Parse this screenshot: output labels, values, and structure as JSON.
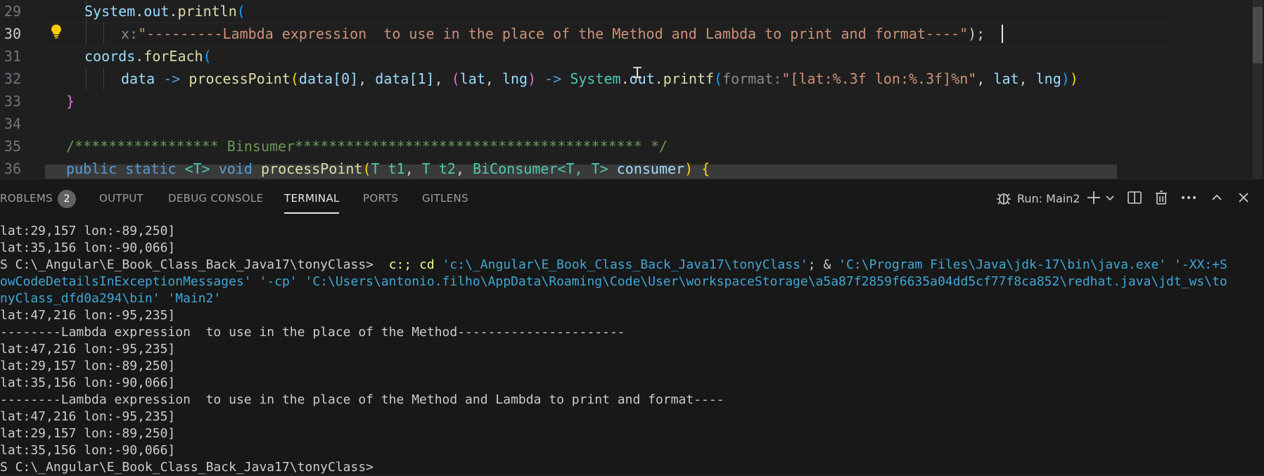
{
  "editor": {
    "line_numbers": [
      "29",
      "30",
      "31",
      "32",
      "33",
      "34",
      "35",
      "36"
    ],
    "tokens": {
      "system": "System",
      "out": "out",
      "println": "println",
      "hint_x": "x:",
      "message": "\"---------Lambda expression  to use in the place of the Method and Lambda to print and format----\"",
      "close_semicolon": ");",
      "coords": "coords",
      "foreach": "forEach",
      "data": "data",
      "arrow": "->",
      "processpoint": "processPoint",
      "data0": "data[0]",
      "data1": "data[1]",
      "lat": "lat",
      "lng": "lng",
      "printf": "printf",
      "hint_format": "format:",
      "format_str": "\"[lat:%.3f lon:%.3f]%n\"",
      "close_brace": "}",
      "comment": "/***************** Binsumer***************************************** */",
      "public": "public",
      "static": "static",
      "generic_t": "<T>",
      "void": "void",
      "param_t1": "T t1",
      "param_t2": "T t2",
      "biconsumer": "BiConsumer<T, T>",
      "consumer": "consumer",
      "open_brace": "{"
    }
  },
  "panel": {
    "tabs": [
      "ROBLEMS",
      "OUTPUT",
      "DEBUG CONSOLE",
      "TERMINAL",
      "PORTS",
      "GITLENS"
    ],
    "problems_count": "2",
    "active_tab": "TERMINAL",
    "run_label": "Run: Main2",
    "icons": [
      "debug-run-icon",
      "add-terminal-icon",
      "chevron-down-icon",
      "split-terminal-icon",
      "trash-icon",
      "more-icon",
      "maximize-icon",
      "close-icon"
    ]
  },
  "terminal": {
    "line1": "lat:29,157 lon:-89,250]",
    "line2": "lat:35,156 lon:-90,066]",
    "prompt_text": "S C:\\_Angular\\E_Book_Class_Back_Java17\\tonyClass>",
    "cmd_c": "c:;",
    "cmd_cd": "cd",
    "cmd_path1": "'c:\\_Angular\\E_Book_Class_Back_Java17\\tonyClass'",
    "cmd_amp": "; &",
    "cmd_java": "'C:\\Program Files\\Java\\jdk-17\\bin\\java.exe' '-XX:+S",
    "wrap2": "owCodeDetailsInExceptionMessages' '-cp' 'C:\\Users\\antonio.filho\\AppData\\Roaming\\Code\\User\\workspaceStorage\\a5a87f2859f6635a04dd5cf77f8ca852\\redhat.java\\jdt_ws\\to",
    "wrap3": "nyClass_dfd0a294\\bin' 'Main2'",
    "line6": "lat:47,216 lon:-95,235]",
    "line7": "--------Lambda expression  to use in the place of the Method----------------------",
    "line8": "lat:47,216 lon:-95,235]",
    "line9": "lat:29,157 lon:-89,250]",
    "line10": "lat:35,156 lon:-90,066]",
    "line11": "--------Lambda expression  to use in the place of the Method and Lambda to print and format----",
    "line12": "lat:47,216 lon:-95,235]",
    "line13": "lat:29,157 lon:-89,250]",
    "line14": "lat:35,156 lon:-90,066]",
    "line15": "S C:\\_Angular\\E_Book_Class_Back_Java17\\tonyClass>"
  }
}
